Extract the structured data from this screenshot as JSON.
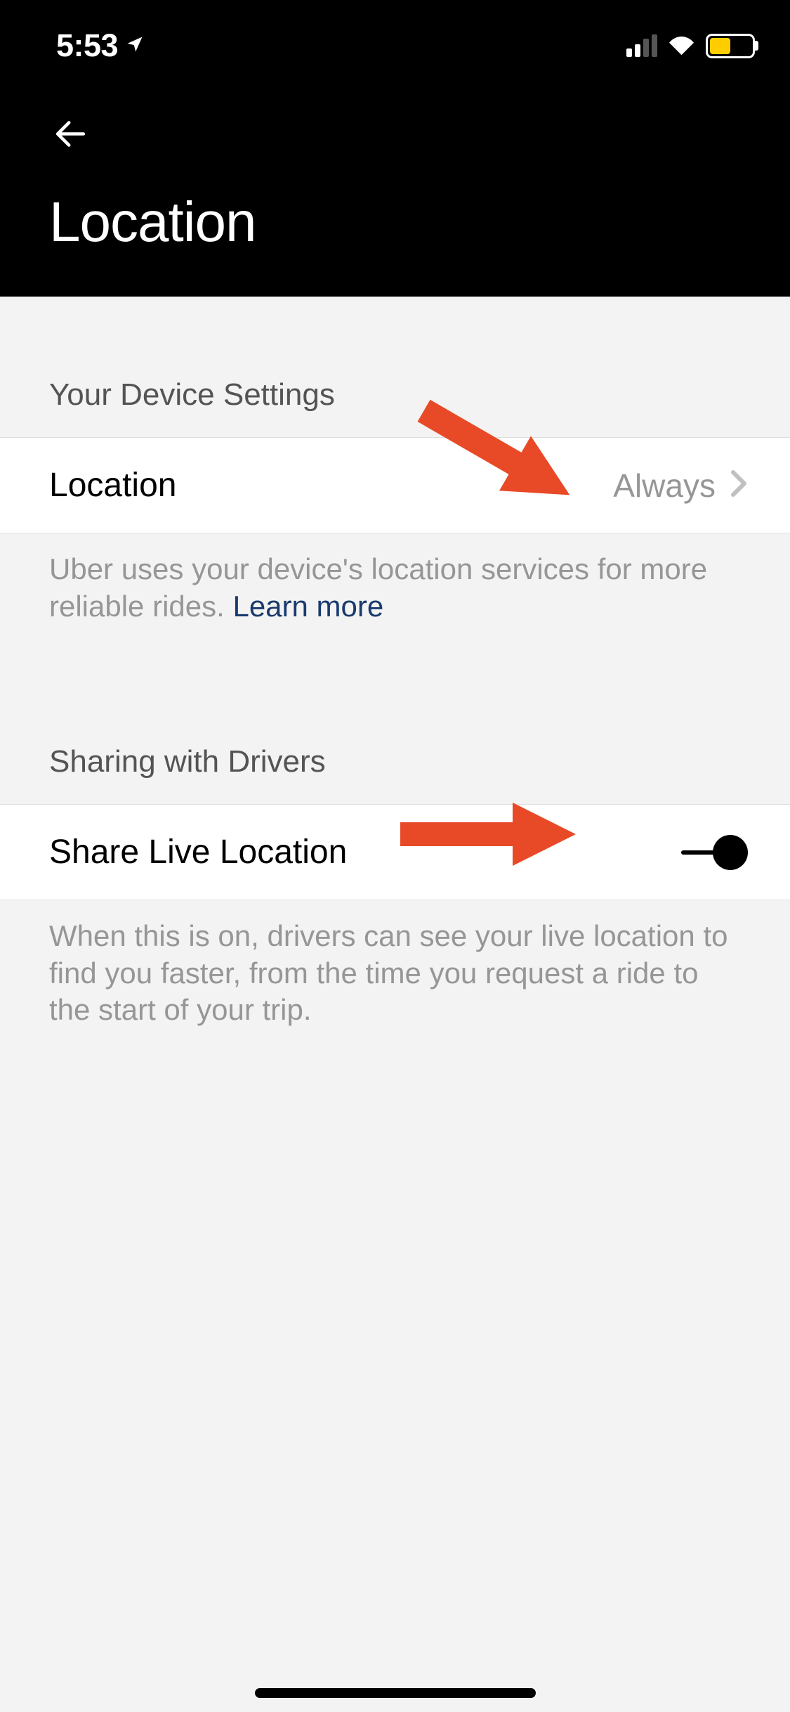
{
  "status_bar": {
    "time": "5:53"
  },
  "header": {
    "title": "Location"
  },
  "sections": {
    "device": {
      "title": "Your Device Settings",
      "row": {
        "label": "Location",
        "value": "Always"
      },
      "description": "Uber uses your device's location services for more reliable rides. ",
      "learn_more": "Learn more"
    },
    "sharing": {
      "title": "Sharing with Drivers",
      "row": {
        "label": "Share Live Location",
        "toggle_on": true
      },
      "description": "When this is on, drivers can see your live location to find you faster, from the time you request a ride to the start of your trip."
    }
  },
  "annotations": {
    "arrow_color": "#e84a27"
  }
}
